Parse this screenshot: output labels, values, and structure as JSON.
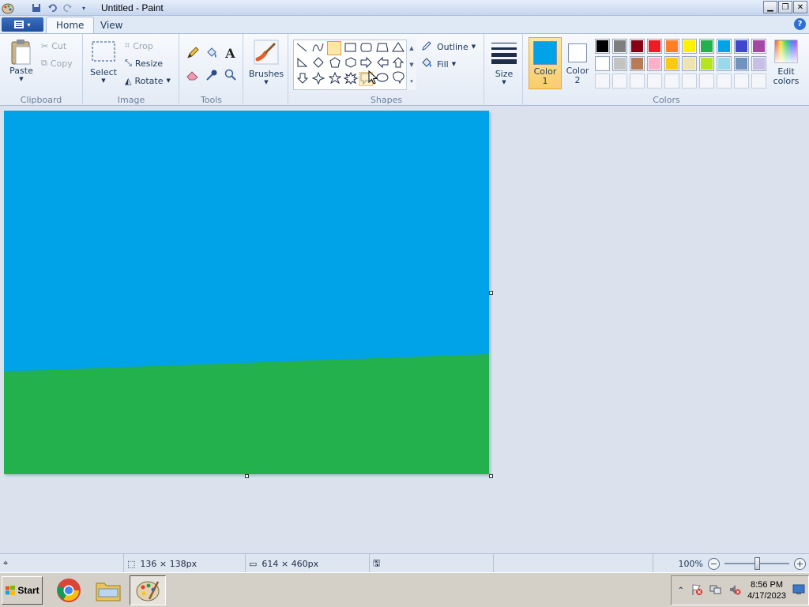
{
  "window": {
    "title": "Untitled - Paint"
  },
  "tabs": {
    "home": "Home",
    "view": "View"
  },
  "clipboard": {
    "paste": "Paste",
    "cut": "Cut",
    "copy": "Copy",
    "group_label": "Clipboard"
  },
  "image": {
    "select": "Select",
    "crop": "Crop",
    "resize": "Resize",
    "rotate": "Rotate",
    "group_label": "Image"
  },
  "tools": {
    "group_label": "Tools"
  },
  "brushes": {
    "label": "Brushes"
  },
  "shapes": {
    "outline": "Outline",
    "fill": "Fill",
    "group_label": "Shapes"
  },
  "size": {
    "label": "Size"
  },
  "colors": {
    "color1_label_line1": "Color",
    "color1_label_line2": "1",
    "color2_label_line1": "Color",
    "color2_label_line2": "2",
    "color1_value": "#00a2e8",
    "color2_value": "#ffffff",
    "edit_line1": "Edit",
    "edit_line2": "colors",
    "group_label": "Colors",
    "palette_row1": [
      "#000000",
      "#7f7f7f",
      "#880015",
      "#ed1c24",
      "#ff7f27",
      "#fff200",
      "#22b14c",
      "#00a2e8",
      "#3f48cc",
      "#a349a4"
    ],
    "palette_row2": [
      "#ffffff",
      "#c3c3c3",
      "#b97a57",
      "#ffaec9",
      "#ffc90e",
      "#efe4b0",
      "#b5e61d",
      "#99d9ea",
      "#7092be",
      "#c8bfe7"
    ]
  },
  "canvas": {
    "sky_color": "#00a2e8",
    "grass_color": "#22b14c"
  },
  "status": {
    "selection_size": "136 × 138px",
    "canvas_size": "614 × 460px",
    "zoom": "100%"
  },
  "taskbar": {
    "start": "Start",
    "time": "8:56 PM",
    "date": "4/17/2023"
  }
}
